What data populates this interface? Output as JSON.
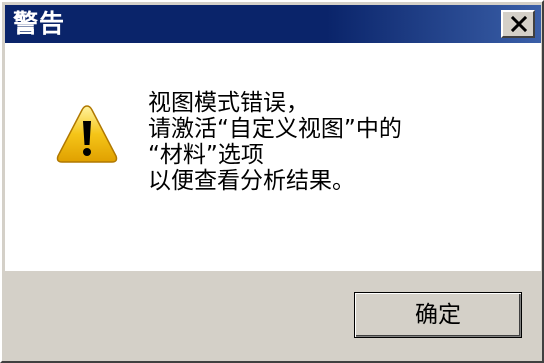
{
  "dialog": {
    "title": "警告",
    "message_lines": [
      "视图模式错误，",
      "请激活“自定义视图”中的",
      "“材料”选项",
      "以便查看分析结果。"
    ],
    "ok_label": "确定",
    "icon": "warning-icon",
    "close_icon": "close-icon"
  },
  "colors": {
    "titlebar": "#0a246a",
    "window_face": "#d4d0c8",
    "content_bg": "#ffffff",
    "warning_yellow": "#f5c518"
  }
}
